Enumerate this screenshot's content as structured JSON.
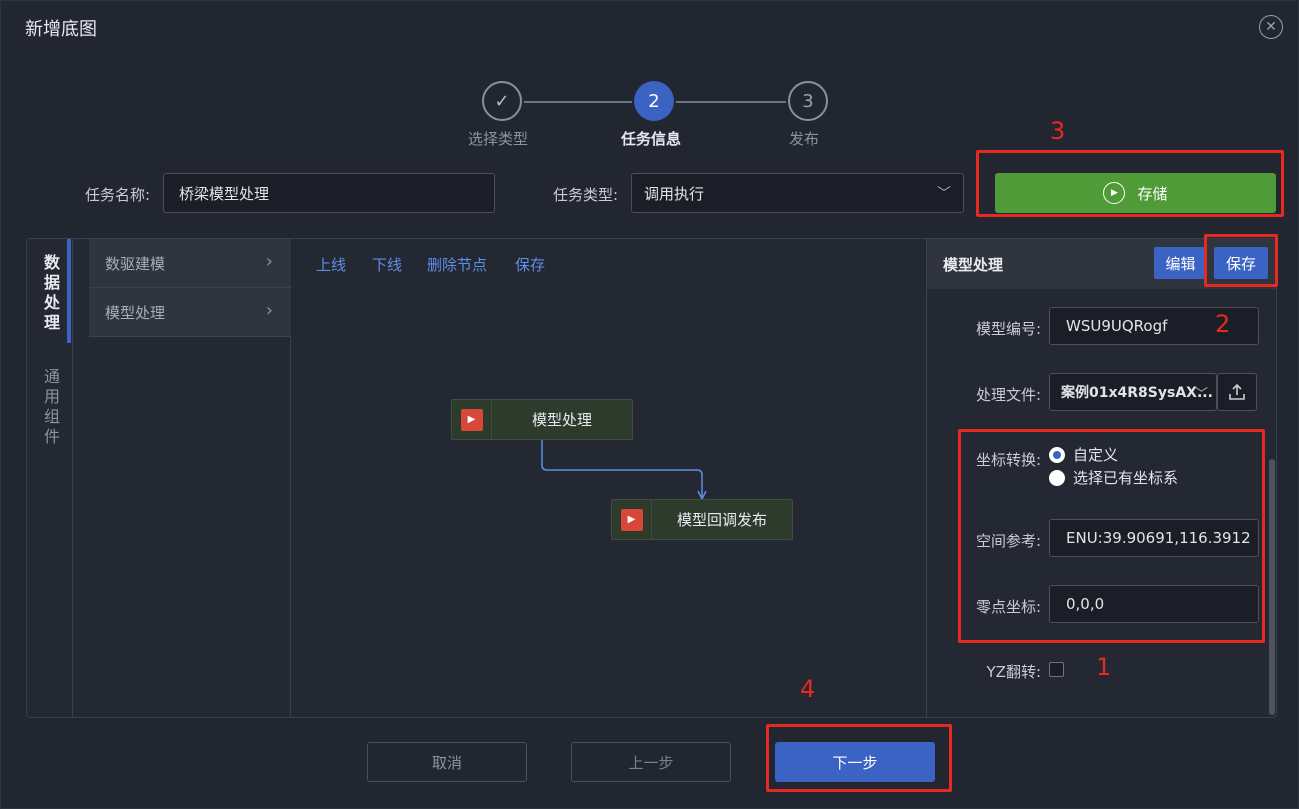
{
  "dialog": {
    "title": "新增底图",
    "close_icon": "close-circle-icon"
  },
  "stepper": {
    "steps": [
      {
        "label": "选择类型",
        "mark": "✓",
        "state": "done"
      },
      {
        "label": "任务信息",
        "mark": "2",
        "state": "active"
      },
      {
        "label": "发布",
        "mark": "3",
        "state": "todo"
      }
    ]
  },
  "form": {
    "task_name_label": "任务名称:",
    "task_name_value": "桥梁模型处理",
    "task_type_label": "任务类型:",
    "task_type_value": "调用执行",
    "store_button": "存储"
  },
  "sidebar_tabs": [
    {
      "label": "数据处理",
      "active": true
    },
    {
      "label": "通用组件",
      "active": false
    }
  ],
  "menu": {
    "items": [
      {
        "label": "数驱建模"
      },
      {
        "label": "模型处理"
      }
    ]
  },
  "toolbar": {
    "online": "上线",
    "offline": "下线",
    "delete_node": "删除节点",
    "save": "保存"
  },
  "flow": {
    "nodes": [
      {
        "label": "模型处理"
      },
      {
        "label": "模型回调发布"
      }
    ]
  },
  "props": {
    "title": "模型处理",
    "edit_button": "编辑",
    "save_button": "保存",
    "model_id_label": "模型编号:",
    "model_id_value": "WSU9UQRogf",
    "file_label": "处理文件:",
    "file_value": "案例01x4R8SysAX...",
    "coord_label": "坐标转换:",
    "coord_options": [
      {
        "label": "自定义",
        "checked": true
      },
      {
        "label": "选择已有坐标系",
        "checked": false
      }
    ],
    "spatial_label": "空间参考:",
    "spatial_value": "ENU:39.90691,116.3912",
    "origin_label": "零点坐标:",
    "origin_value": "0,0,0",
    "yz_label": "YZ翻转:",
    "yz_checked": false
  },
  "annotations": {
    "n1": "1",
    "n2": "2",
    "n3": "3",
    "n4": "4",
    "color": "#e52a22"
  },
  "footer": {
    "cancel": "取消",
    "prev": "上一步",
    "next": "下一步"
  },
  "colors": {
    "accent": "#3b63c4",
    "store_green": "#4f9b37",
    "node_play_red": "#d9473a",
    "link_blue": "#5d8ee8"
  }
}
